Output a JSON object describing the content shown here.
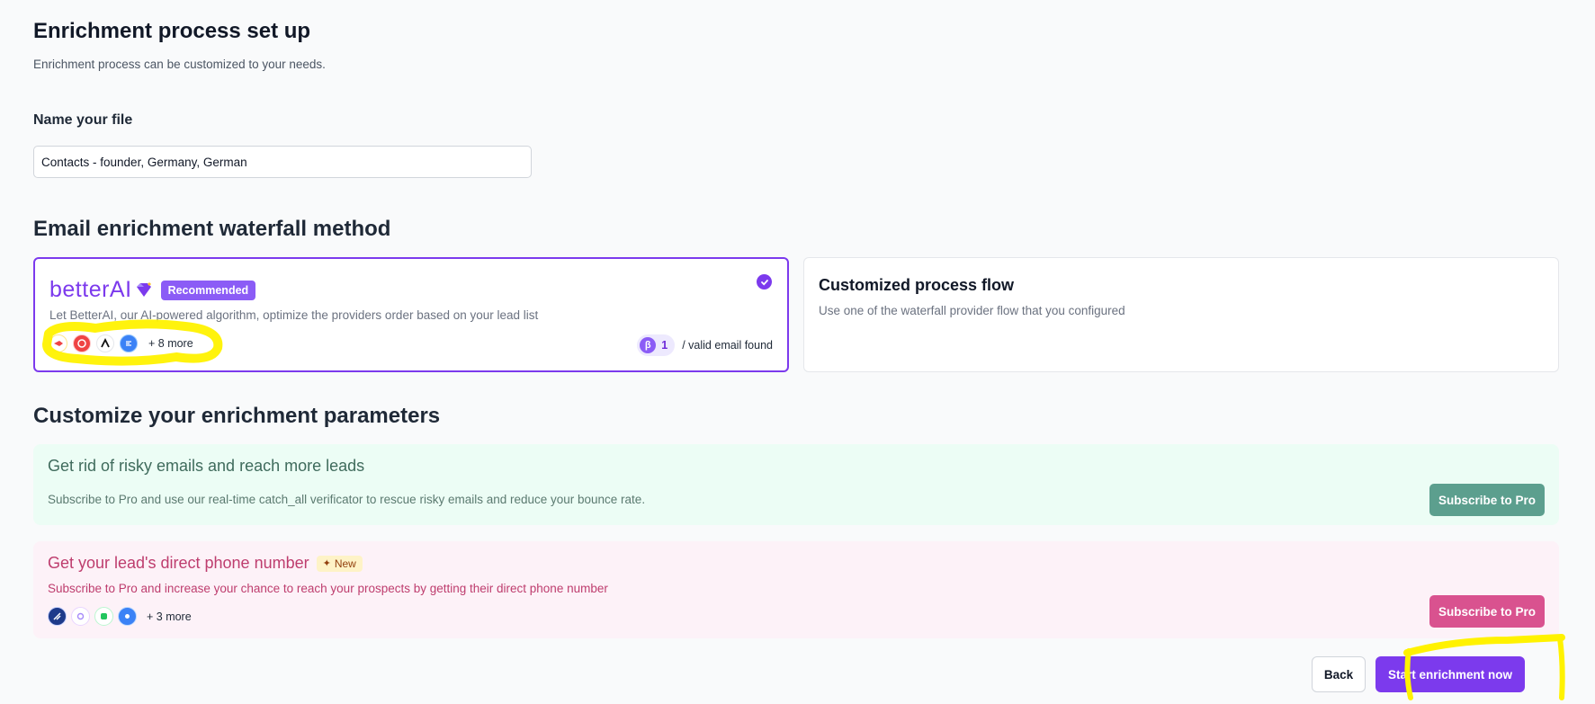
{
  "header": {
    "title": "Enrichment process set up",
    "subtitle": "Enrichment process can be customized to your needs."
  },
  "file_name": {
    "label": "Name your file",
    "value": "Contacts - founder, Germany, German"
  },
  "waterfall": {
    "title": "Email enrichment waterfall method",
    "better_ai": {
      "brand": "betterAI",
      "badge": "Recommended",
      "selected": true,
      "description": "Let BetterAI, our AI-powered algorithm, optimize the providers order based on your lead list",
      "providers": [
        "rocket-provider-icon",
        "red-circle-provider-icon",
        "triangle-provider-icon",
        "blue-lines-provider-icon"
      ],
      "more_label": "+ 8 more",
      "credits": "1",
      "credits_label": "/ valid email found"
    },
    "custom": {
      "title": "Customized process flow",
      "description": "Use one of the waterfall provider flow that you configured"
    }
  },
  "params": {
    "title": "Customize your enrichment parameters",
    "risky": {
      "title": "Get rid of risky emails and reach more leads",
      "text": "Subscribe to Pro and use our real-time catch_all verificator to rescue risky emails and reduce your bounce rate.",
      "button": "Subscribe to Pro"
    },
    "phone": {
      "title": "Get your lead's direct phone number",
      "badge": "New",
      "text": "Subscribe to Pro and increase your chance to reach your prospects by getting their direct phone number",
      "button": "Subscribe to Pro",
      "providers": [
        "rocket-phone-provider-icon",
        "swirl-phone-provider-icon",
        "green-phone-provider-icon",
        "blue-phone-provider-icon"
      ],
      "more_label": "+ 3 more"
    }
  },
  "footer": {
    "back": "Back",
    "start": "Start enrichment now"
  },
  "colors": {
    "accent": "#7c3aed",
    "risky_bg": "#ecfdf5",
    "risky_button": "#5c9f8e",
    "phone_bg": "#fdf2f8",
    "phone_button": "#d9528f",
    "highlight": "#fff200"
  }
}
